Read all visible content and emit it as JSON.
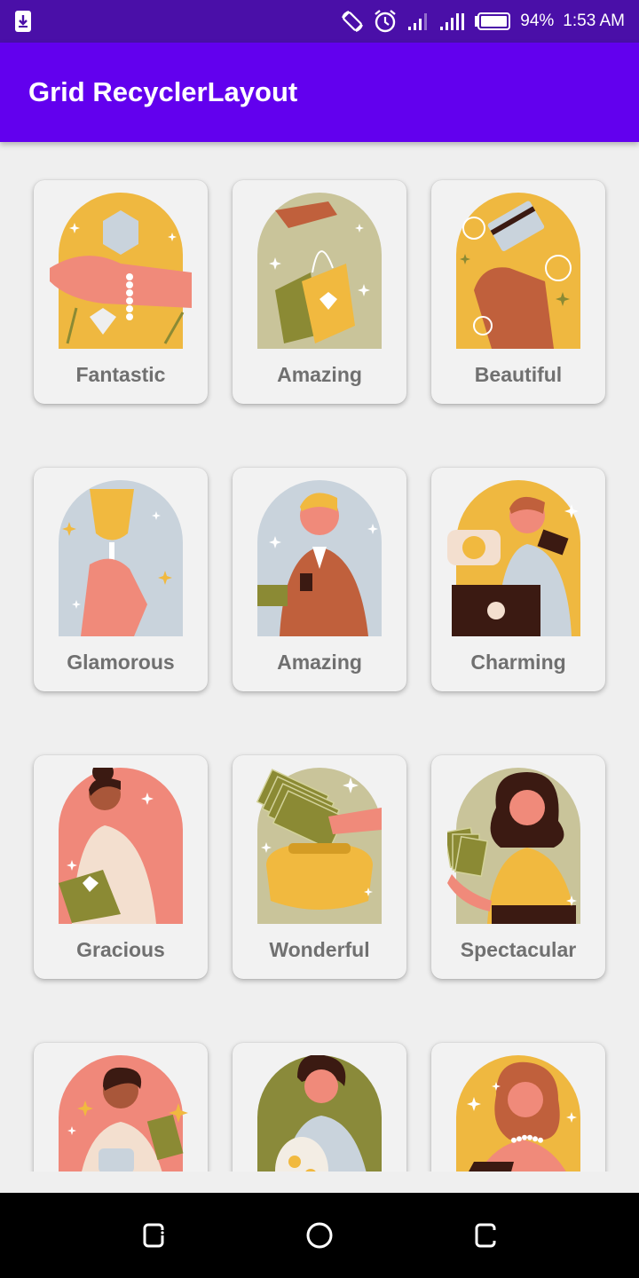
{
  "status_bar": {
    "battery_percent": "94%",
    "time": "1:53 AM"
  },
  "app_bar": {
    "title": "Grid RecyclerLayout"
  },
  "colors": {
    "status_bar": "#4a0fa8",
    "app_bar": "#6200ee",
    "background": "#efefef",
    "card": "#f2f2f2",
    "label": "#707070"
  },
  "cards": [
    {
      "label": "Fantastic",
      "illustration": "hand-with-diamond",
      "bg": "#efb840"
    },
    {
      "label": "Amazing",
      "illustration": "hand-holding-shopping-bag",
      "bg": "#c9c49a"
    },
    {
      "label": "Beautiful",
      "illustration": "hand-holding-credit-card",
      "bg": "#efb840"
    },
    {
      "label": "Glamorous",
      "illustration": "hand-holding-glass",
      "bg": "#c9d3dc"
    },
    {
      "label": "Amazing",
      "illustration": "man-with-wallet",
      "bg": "#c9d3dc"
    },
    {
      "label": "Charming",
      "illustration": "man-with-laptop-and-card",
      "bg": "#efb840"
    },
    {
      "label": "Gracious",
      "illustration": "woman-with-shopping-bag",
      "bg": "#f0887a"
    },
    {
      "label": "Wonderful",
      "illustration": "purse-with-money",
      "bg": "#c9c49a"
    },
    {
      "label": "Spectacular",
      "illustration": "woman-holding-cash",
      "bg": "#c9c49a"
    },
    {
      "label": "",
      "illustration": "man-holding-cash",
      "bg": "#f0887a"
    },
    {
      "label": "",
      "illustration": "woman-with-coin-jar",
      "bg": "#8a8a3a"
    },
    {
      "label": "",
      "illustration": "woman-with-pearl-necklace",
      "bg": "#efb840"
    }
  ]
}
